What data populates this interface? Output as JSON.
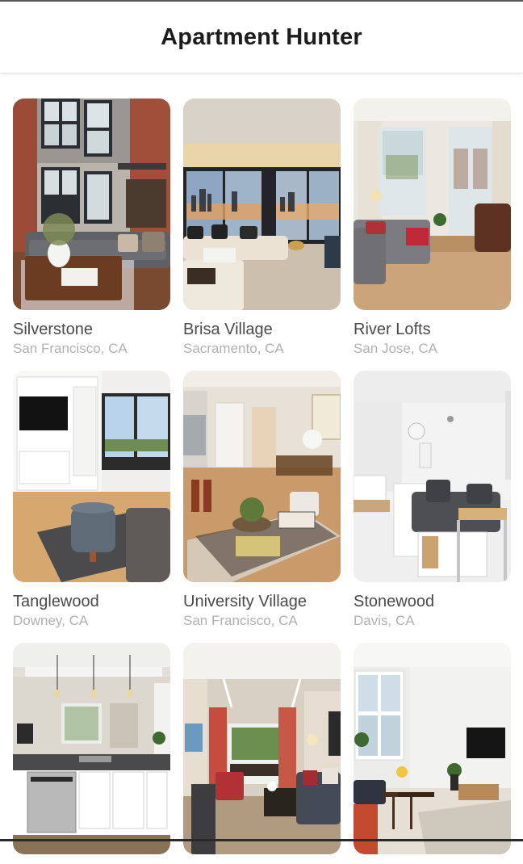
{
  "header": {
    "title": "Apartment Hunter"
  },
  "listings": [
    {
      "name": "Silverstone",
      "location": "San Francisco, CA",
      "image": "loft-living-room-photo"
    },
    {
      "name": "Brisa Village",
      "location": "Sacramento, CA",
      "image": "city-view-living-room-photo"
    },
    {
      "name": "River Lofts",
      "location": "San Jose, CA",
      "image": "bright-lounge-photo"
    },
    {
      "name": "Tanglewood",
      "location": "Downey, CA",
      "image": "living-room-tv-photo"
    },
    {
      "name": "University Village",
      "location": "San Francisco, CA",
      "image": "open-plan-dining-photo"
    },
    {
      "name": "Stonewood",
      "location": "Davis, CA",
      "image": "white-studio-photo"
    },
    {
      "name": "",
      "location": "",
      "image": "kitchen-photo"
    },
    {
      "name": "",
      "location": "",
      "image": "balcony-living-room-photo"
    },
    {
      "name": "",
      "location": "",
      "image": "white-room-tv-photo"
    }
  ]
}
